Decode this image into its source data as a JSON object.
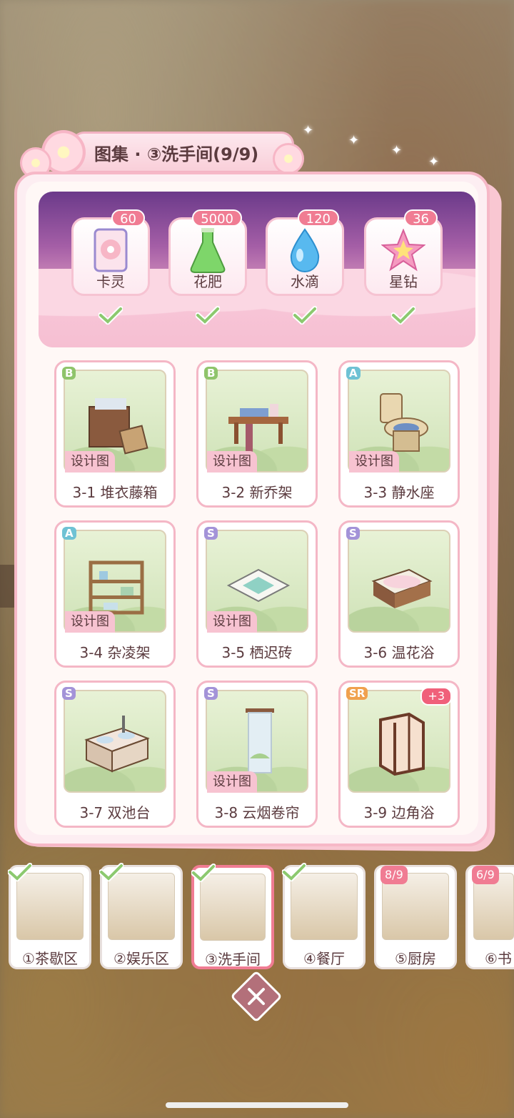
{
  "title": "图集 · ③洗手间(9/9)",
  "rewards": [
    {
      "label": "卡灵",
      "count": "60",
      "icon": "card-icon"
    },
    {
      "label": "花肥",
      "count": "5000",
      "icon": "fertilizer-flask-icon"
    },
    {
      "label": "水滴",
      "count": "120",
      "icon": "water-drop-icon"
    },
    {
      "label": "星钻",
      "count": "36",
      "icon": "star-gem-icon"
    }
  ],
  "design_label": "设计图",
  "items": [
    {
      "name": "3-1 堆衣藤箱",
      "rarity": "B"
    },
    {
      "name": "3-2 新乔架",
      "rarity": "B"
    },
    {
      "name": "3-3 静水座",
      "rarity": "A"
    },
    {
      "name": "3-4 杂凌架",
      "rarity": "A"
    },
    {
      "name": "3-5 栖迟砖",
      "rarity": "S"
    },
    {
      "name": "3-6 温花浴",
      "rarity": "S"
    },
    {
      "name": "3-7 双池台",
      "rarity": "S"
    },
    {
      "name": "3-8 云烟卷帘",
      "rarity": "S"
    },
    {
      "name": "3-9 边角浴",
      "rarity": "SR",
      "plus": "+3"
    }
  ],
  "tabs": [
    {
      "label": "①茶歇区",
      "completed": true
    },
    {
      "label": "②娱乐区",
      "completed": true
    },
    {
      "label": "③洗手间",
      "completed": true,
      "active": true
    },
    {
      "label": "④餐厅",
      "completed": true
    },
    {
      "label": "⑤厨房",
      "progress": "8/9"
    },
    {
      "label": "⑥书",
      "progress": "6/9"
    }
  ],
  "colors": {
    "accent": "#f07c93",
    "panel_border": "#f6b8c7",
    "text": "#5b3b3f"
  }
}
